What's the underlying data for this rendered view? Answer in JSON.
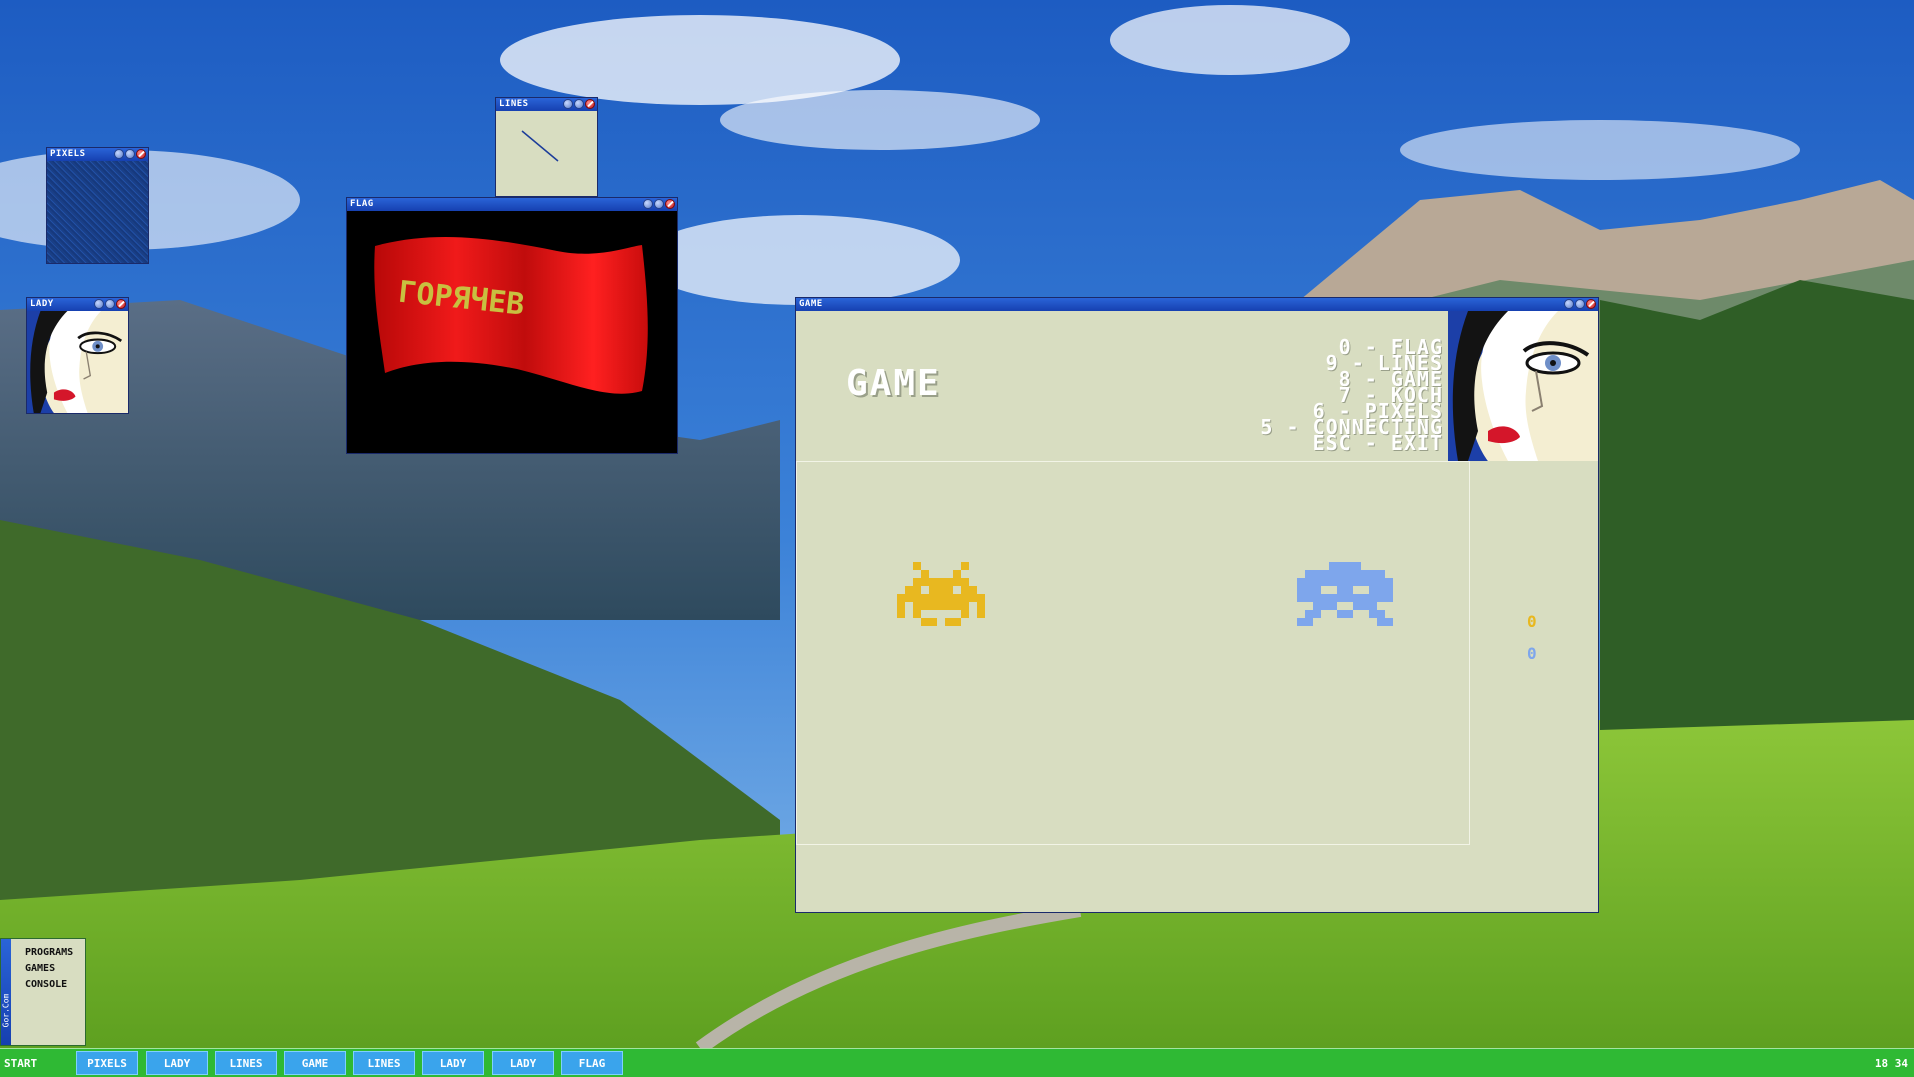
{
  "windows": {
    "pixels": {
      "title": "PIXELS"
    },
    "lines": {
      "title": "LINES"
    },
    "flag": {
      "title": "FLAG",
      "flag_text": "ГОРЯЧЕВ",
      "flag_color": "#e31010",
      "text_color": "#c8c040"
    },
    "lady": {
      "title": "LADY"
    },
    "game": {
      "title": "GAME",
      "heading": "GAME",
      "menu": [
        "0 - FLAG",
        "9 - LINES",
        "8 - GAME",
        "7 - KOCH",
        "6 - PIXELS",
        "5 - CONNECTING",
        "ESC - EXIT"
      ],
      "score_yellow": "0",
      "score_blue": "0",
      "invader_yellow_color": "#e8b820",
      "invader_blue_color": "#7ea6ec"
    }
  },
  "start_menu": {
    "items": [
      "PROGRAMS",
      "GAMES",
      "CONSOLE"
    ],
    "side_label": "Gor.Com"
  },
  "taskbar": {
    "start_label": "START",
    "tasks": [
      "PIXELS",
      "LADY",
      "LINES",
      "GAME",
      "LINES",
      "LADY",
      "LADY",
      "FLAG"
    ],
    "clock": "18 34"
  }
}
